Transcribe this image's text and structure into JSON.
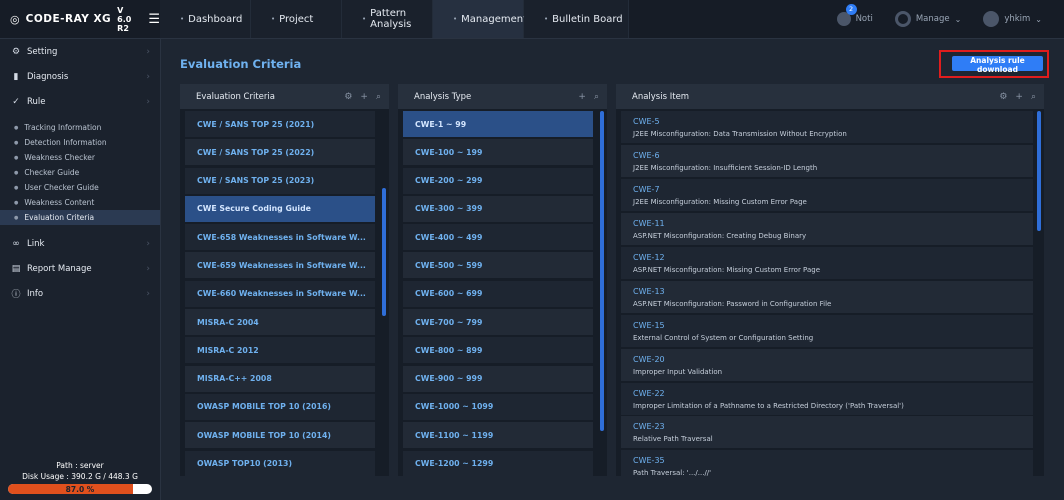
{
  "app": {
    "logo_mark": "◎",
    "logo_text": "CODE-RAY XG",
    "version": "V 6.0 R2"
  },
  "topnav": [
    {
      "label": "Dashboard"
    },
    {
      "label": "Project"
    },
    {
      "label": "Pattern Analysis"
    },
    {
      "label": "Management"
    },
    {
      "label": "Bulletin Board"
    }
  ],
  "topright": {
    "noti_label": "Noti",
    "noti_count": "2",
    "manage_label": "Manage",
    "user_label": "yhkim"
  },
  "sidebar": {
    "sections": [
      {
        "label": "Setting",
        "icon": "gear-icon"
      },
      {
        "label": "Diagnosis",
        "icon": "bar-chart-icon"
      },
      {
        "label": "Rule",
        "icon": "check-circle-icon"
      },
      {
        "label": "Link",
        "icon": "link-icon"
      },
      {
        "label": "Report Manage",
        "icon": "report-icon"
      },
      {
        "label": "Info",
        "icon": "info-icon"
      }
    ],
    "rule_items": [
      "Tracking Information",
      "Detection Information",
      "Weakness Checker",
      "Checker Guide",
      "User Checker Guide",
      "Weakness Content",
      "Evaluation Criteria"
    ],
    "active_item": "Evaluation Criteria",
    "footer": {
      "path": "Path : server",
      "disk_usage": "Disk Usage : 390.2 G / 448.3 G",
      "disk_percent_label": "87.0 %",
      "disk_percent": 87.0,
      "bar_color": "#e0501d"
    }
  },
  "page": {
    "title": "Evaluation Criteria",
    "download_button": "Analysis rule download"
  },
  "panels": {
    "criteria": {
      "title": "Evaluation Criteria",
      "rows": [
        "CWE / SANS TOP 25 (2021)",
        "CWE / SANS TOP 25 (2022)",
        "CWE / SANS TOP 25 (2023)",
        "CWE Secure Coding Guide",
        "CWE-658 Weaknesses in Software W...",
        "CWE-659 Weaknesses in Software W...",
        "CWE-660 Weaknesses in Software W...",
        "MISRA-C 2004",
        "MISRA-C 2012",
        "MISRA-C++ 2008",
        "OWASP MOBILE TOP 10 (2016)",
        "OWASP MOBILE TOP 10 (2014)",
        "OWASP TOP10 (2013)"
      ],
      "selected_index": 3
    },
    "types": {
      "title": "Analysis Type",
      "rows": [
        "CWE-1 ~ 99",
        "CWE-100 ~ 199",
        "CWE-200 ~ 299",
        "CWE-300 ~ 399",
        "CWE-400 ~ 499",
        "CWE-500 ~ 599",
        "CWE-600 ~ 699",
        "CWE-700 ~ 799",
        "CWE-800 ~ 899",
        "CWE-900 ~ 999",
        "CWE-1000 ~ 1099",
        "CWE-1100 ~ 1199",
        "CWE-1200 ~ 1299"
      ],
      "selected_index": 0
    },
    "items": {
      "title": "Analysis Item",
      "rows": [
        {
          "code": "CWE-5",
          "desc": "J2EE Misconfiguration: Data Transmission Without Encryption"
        },
        {
          "code": "CWE-6",
          "desc": "J2EE Misconfiguration: Insufficient Session-ID Length"
        },
        {
          "code": "CWE-7",
          "desc": "J2EE Misconfiguration: Missing Custom Error Page"
        },
        {
          "code": "CWE-11",
          "desc": "ASP.NET Misconfiguration: Creating Debug Binary"
        },
        {
          "code": "CWE-12",
          "desc": "ASP.NET Misconfiguration: Missing Custom Error Page"
        },
        {
          "code": "CWE-13",
          "desc": "ASP.NET Misconfiguration: Password in Configuration File"
        },
        {
          "code": "CWE-15",
          "desc": "External Control of System or Configuration Setting"
        },
        {
          "code": "CWE-20",
          "desc": "Improper Input Validation"
        },
        {
          "code": "CWE-22",
          "desc": "Improper Limitation of a Pathname to a Restricted Directory ('Path Traversal')"
        },
        {
          "code": "CWE-23",
          "desc": "Relative Path Traversal"
        },
        {
          "code": "CWE-35",
          "desc": "Path Traversal: '.../...//'"
        }
      ]
    }
  },
  "colors": {
    "accent": "#2f7df6",
    "link_text": "#6fb1ef",
    "highlight_border": "#e01d1d",
    "selected_row": "#2b5088"
  }
}
